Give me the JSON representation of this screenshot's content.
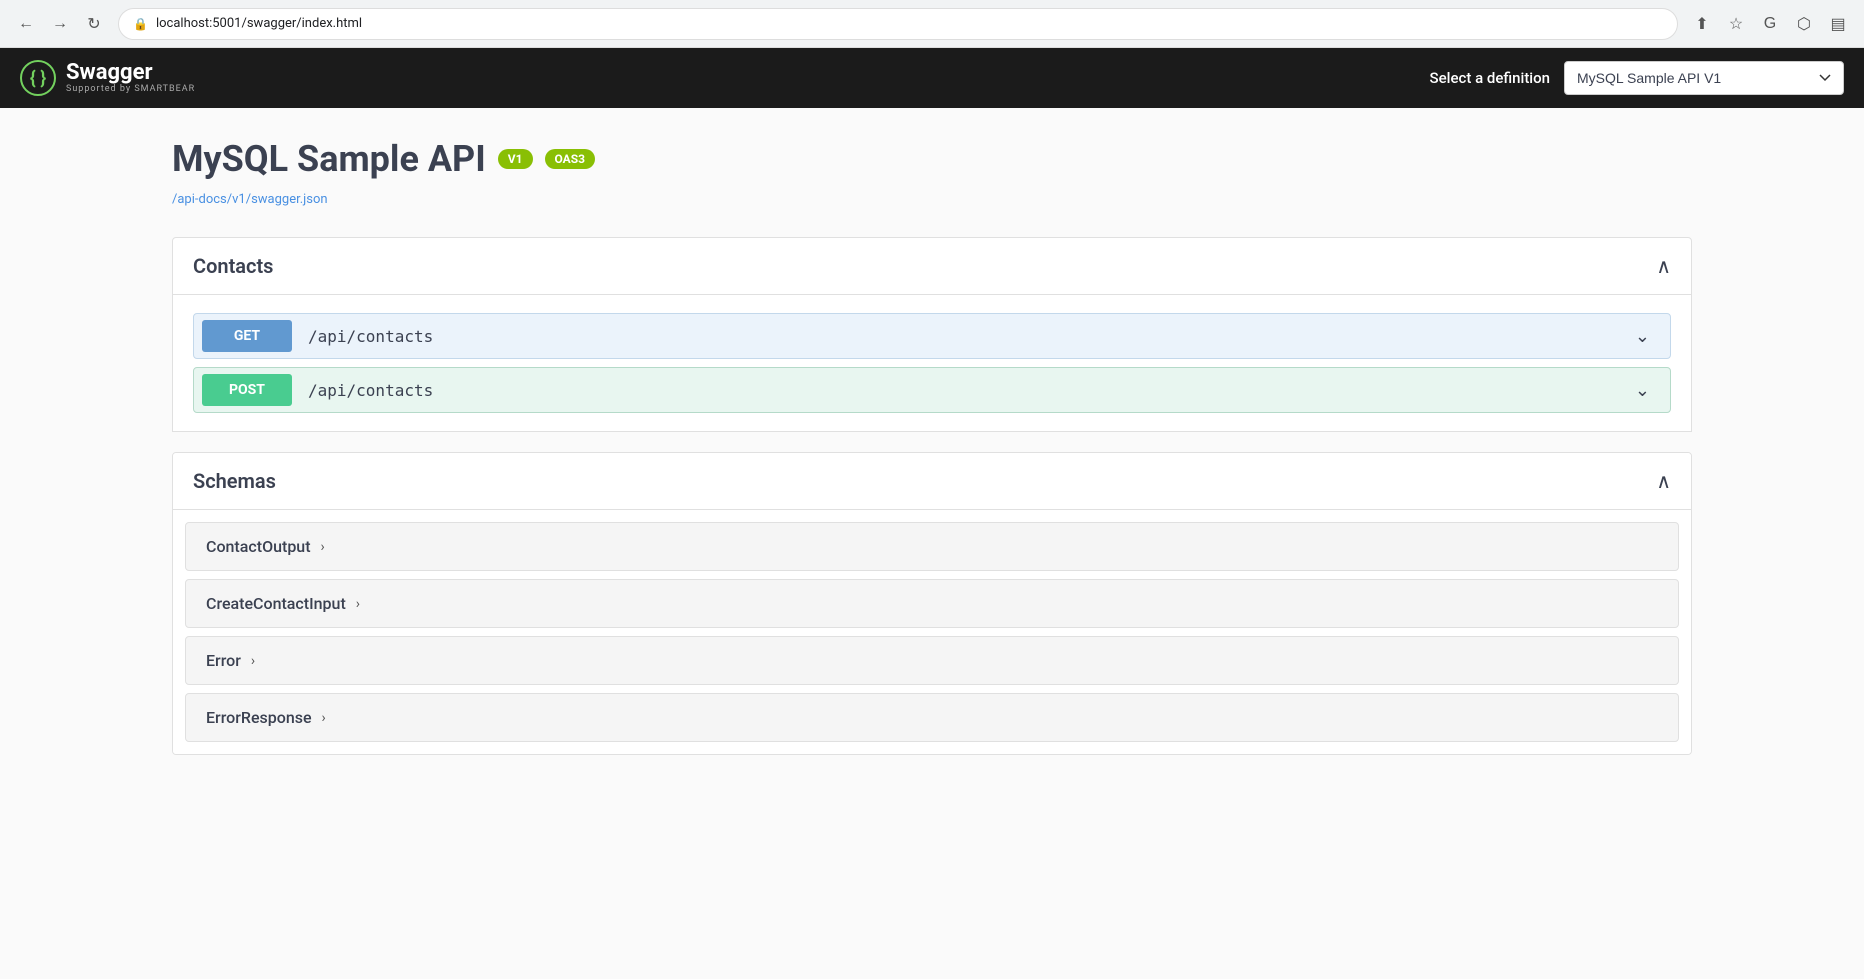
{
  "browser": {
    "url": "localhost:5001/swagger/index.html",
    "back_title": "Back",
    "forward_title": "Forward",
    "reload_title": "Reload"
  },
  "navbar": {
    "logo_icon": "{ }",
    "logo_name": "Swagger",
    "logo_sub": "Supported by SMARTBEAR",
    "definition_label": "Select a definition",
    "definition_value": "MySQL Sample API V1",
    "definition_options": [
      "MySQL Sample API V1"
    ]
  },
  "api": {
    "title": "MySQL Sample API",
    "badge_v1": "V1",
    "badge_oas3": "OAS3",
    "link_text": "/api-docs/v1/swagger.json",
    "link_href": "/api-docs/v1/swagger.json"
  },
  "contacts_section": {
    "title": "Contacts",
    "chevron": "∧",
    "endpoints": [
      {
        "method": "GET",
        "path": "/api/contacts",
        "type": "get"
      },
      {
        "method": "POST",
        "path": "/api/contacts",
        "type": "post"
      }
    ]
  },
  "schemas_section": {
    "title": "Schemas",
    "chevron": "∧",
    "items": [
      {
        "name": "ContactOutput",
        "chevron": "›"
      },
      {
        "name": "CreateContactInput",
        "chevron": "›"
      },
      {
        "name": "Error",
        "chevron": "›"
      },
      {
        "name": "ErrorResponse",
        "chevron": "›"
      }
    ]
  }
}
